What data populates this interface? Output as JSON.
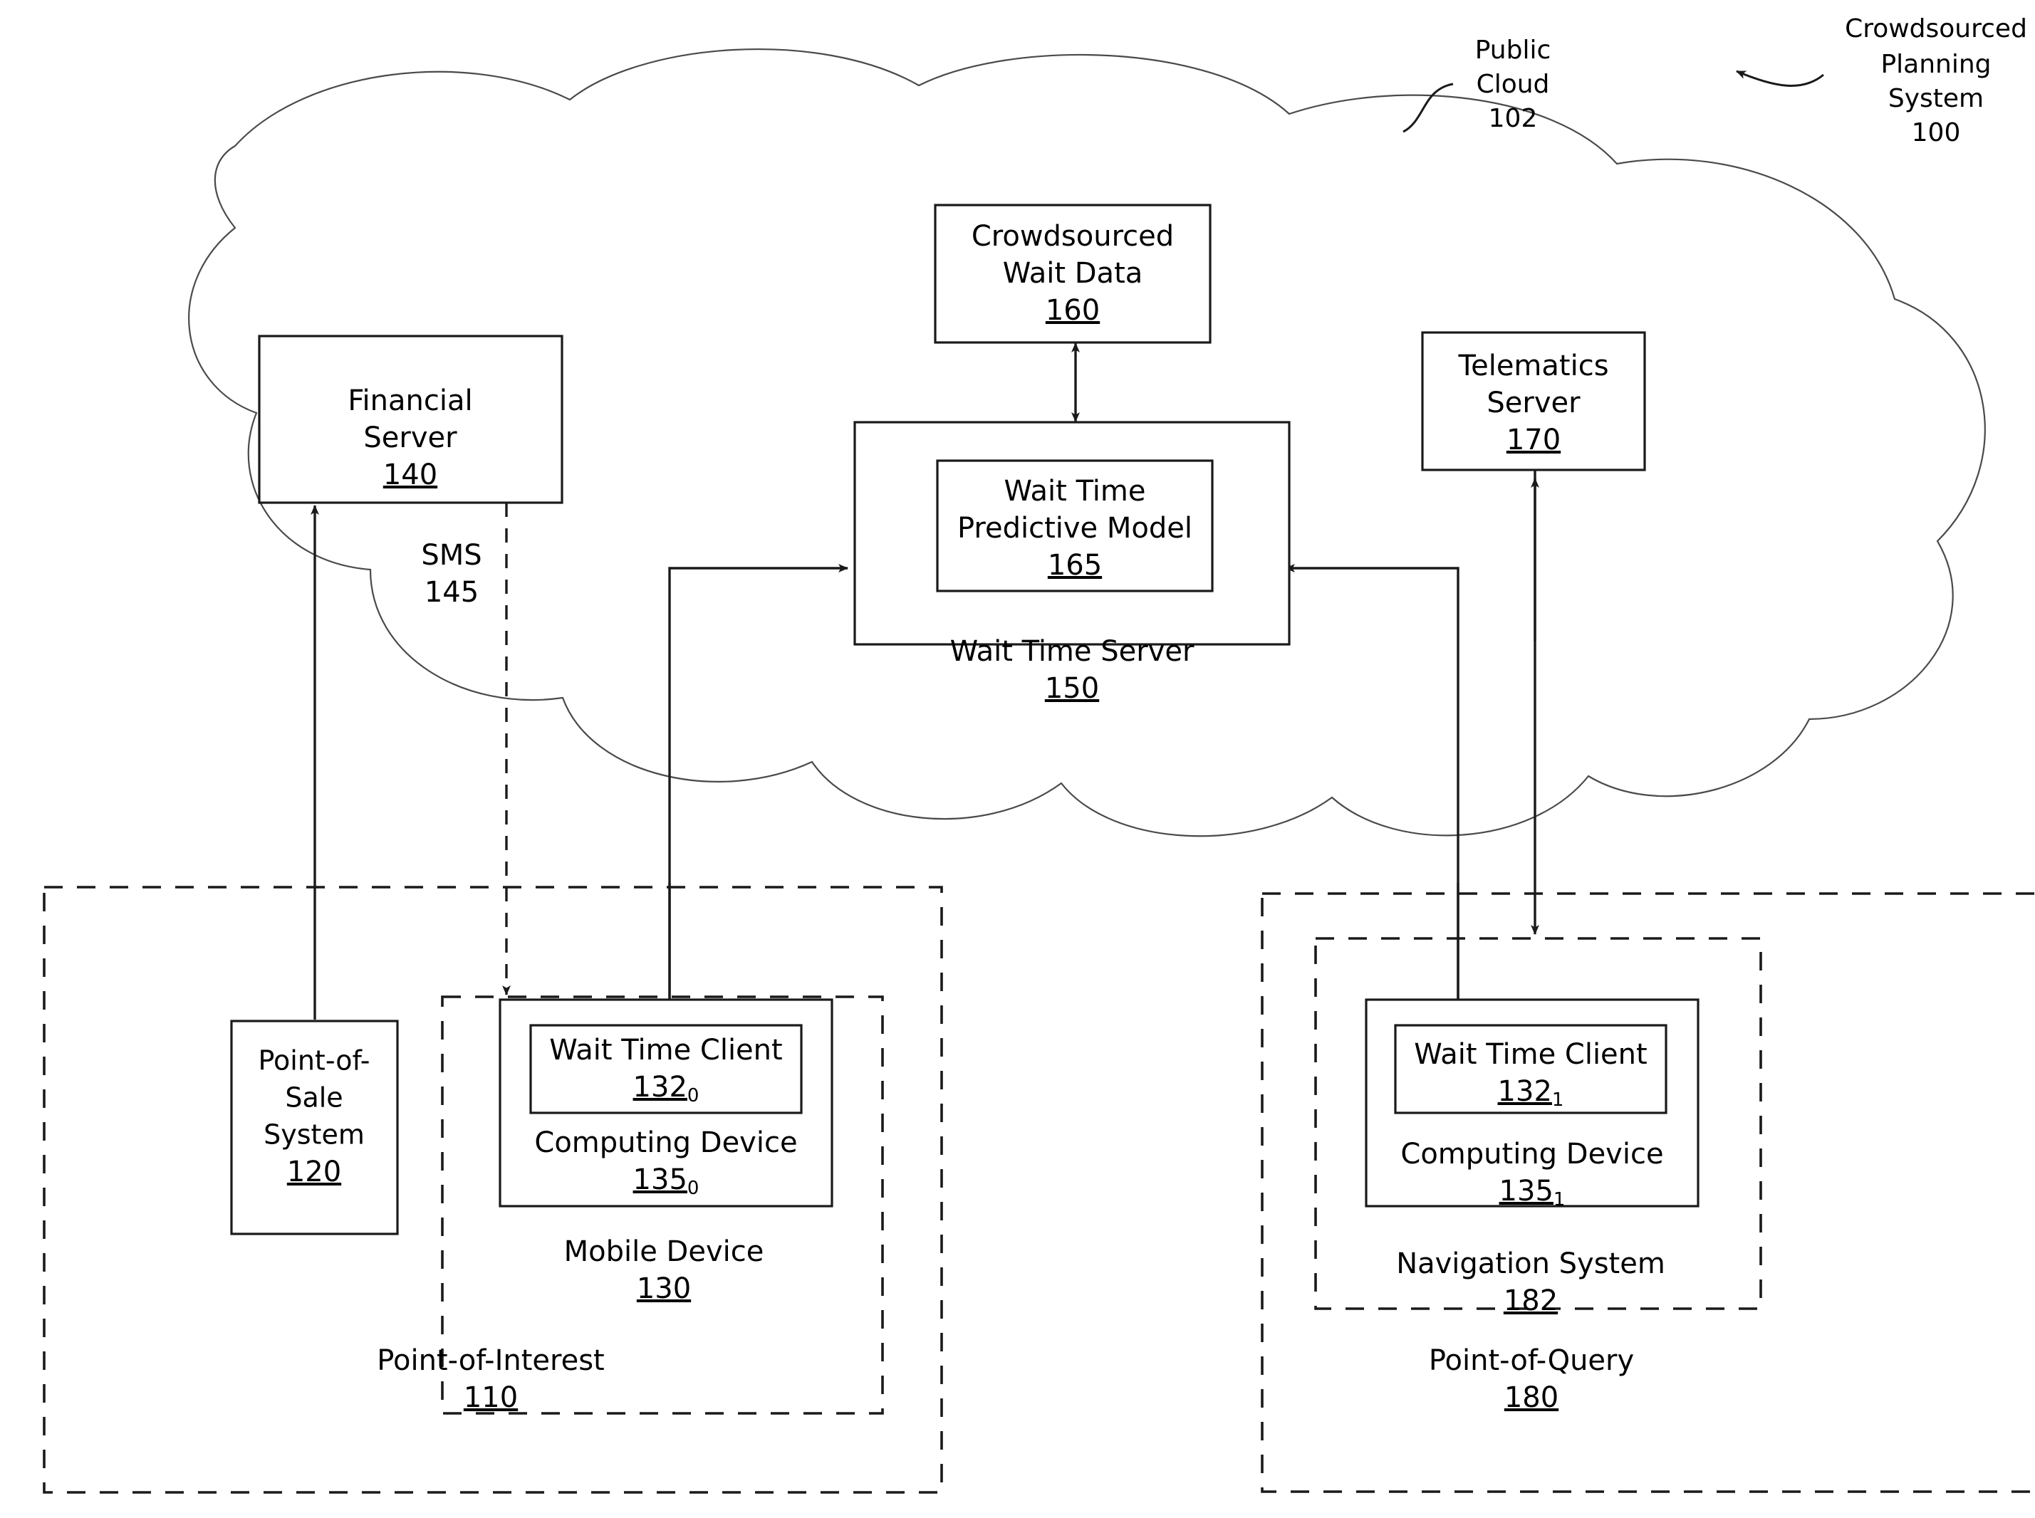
{
  "figure": {
    "system_callout": {
      "name": "Crowdsourced Planning System",
      "line1": "Crowdsourced",
      "line2": "Planning",
      "line3": "System",
      "ref": "100"
    },
    "cloud_callout": {
      "line1": "Public",
      "line2": "Cloud",
      "ref": "102"
    },
    "nodes": {
      "crowdsourced_wait_data": {
        "line1": "Crowdsourced",
        "line2": "Wait Data",
        "ref": "160"
      },
      "wait_time_predictive_model": {
        "line1": "Wait Time",
        "line2": "Predictive Model",
        "ref": "165"
      },
      "wait_time_server": {
        "line1": "Wait Time Server",
        "ref": "150"
      },
      "financial_server": {
        "line1": "Financial",
        "line2": "Server",
        "ref": "140"
      },
      "telematics_server": {
        "line1": "Telematics",
        "line2": "Server",
        "ref": "170"
      },
      "point_of_sale_system": {
        "line1": "Point-of-",
        "line2": "Sale",
        "line3": "System",
        "ref": "120"
      },
      "wait_time_client_0": {
        "line1": "Wait Time Client",
        "ref": "132",
        "ref_sub": "0"
      },
      "computing_device_0": {
        "line1": "Computing Device",
        "ref": "135",
        "ref_sub": "0"
      },
      "mobile_device": {
        "line1": "Mobile Device",
        "ref": "130"
      },
      "point_of_interest": {
        "line1": "Point-of-Interest",
        "ref": "110"
      },
      "wait_time_client_1": {
        "line1": "Wait Time Client",
        "ref": "132",
        "ref_sub": "1"
      },
      "computing_device_1": {
        "line1": "Computing Device",
        "ref": "135",
        "ref_sub": "1"
      },
      "navigation_system": {
        "line1": "Navigation System",
        "ref": "182"
      },
      "point_of_query": {
        "line1": "Point-of-Query",
        "ref": "180"
      }
    },
    "edges": {
      "sms": {
        "label": "SMS",
        "ref": "145"
      }
    },
    "colors": {
      "ink": "#1a1a1a",
      "cloud_stroke": "#4a4a4a",
      "background": "#ffffff"
    }
  }
}
